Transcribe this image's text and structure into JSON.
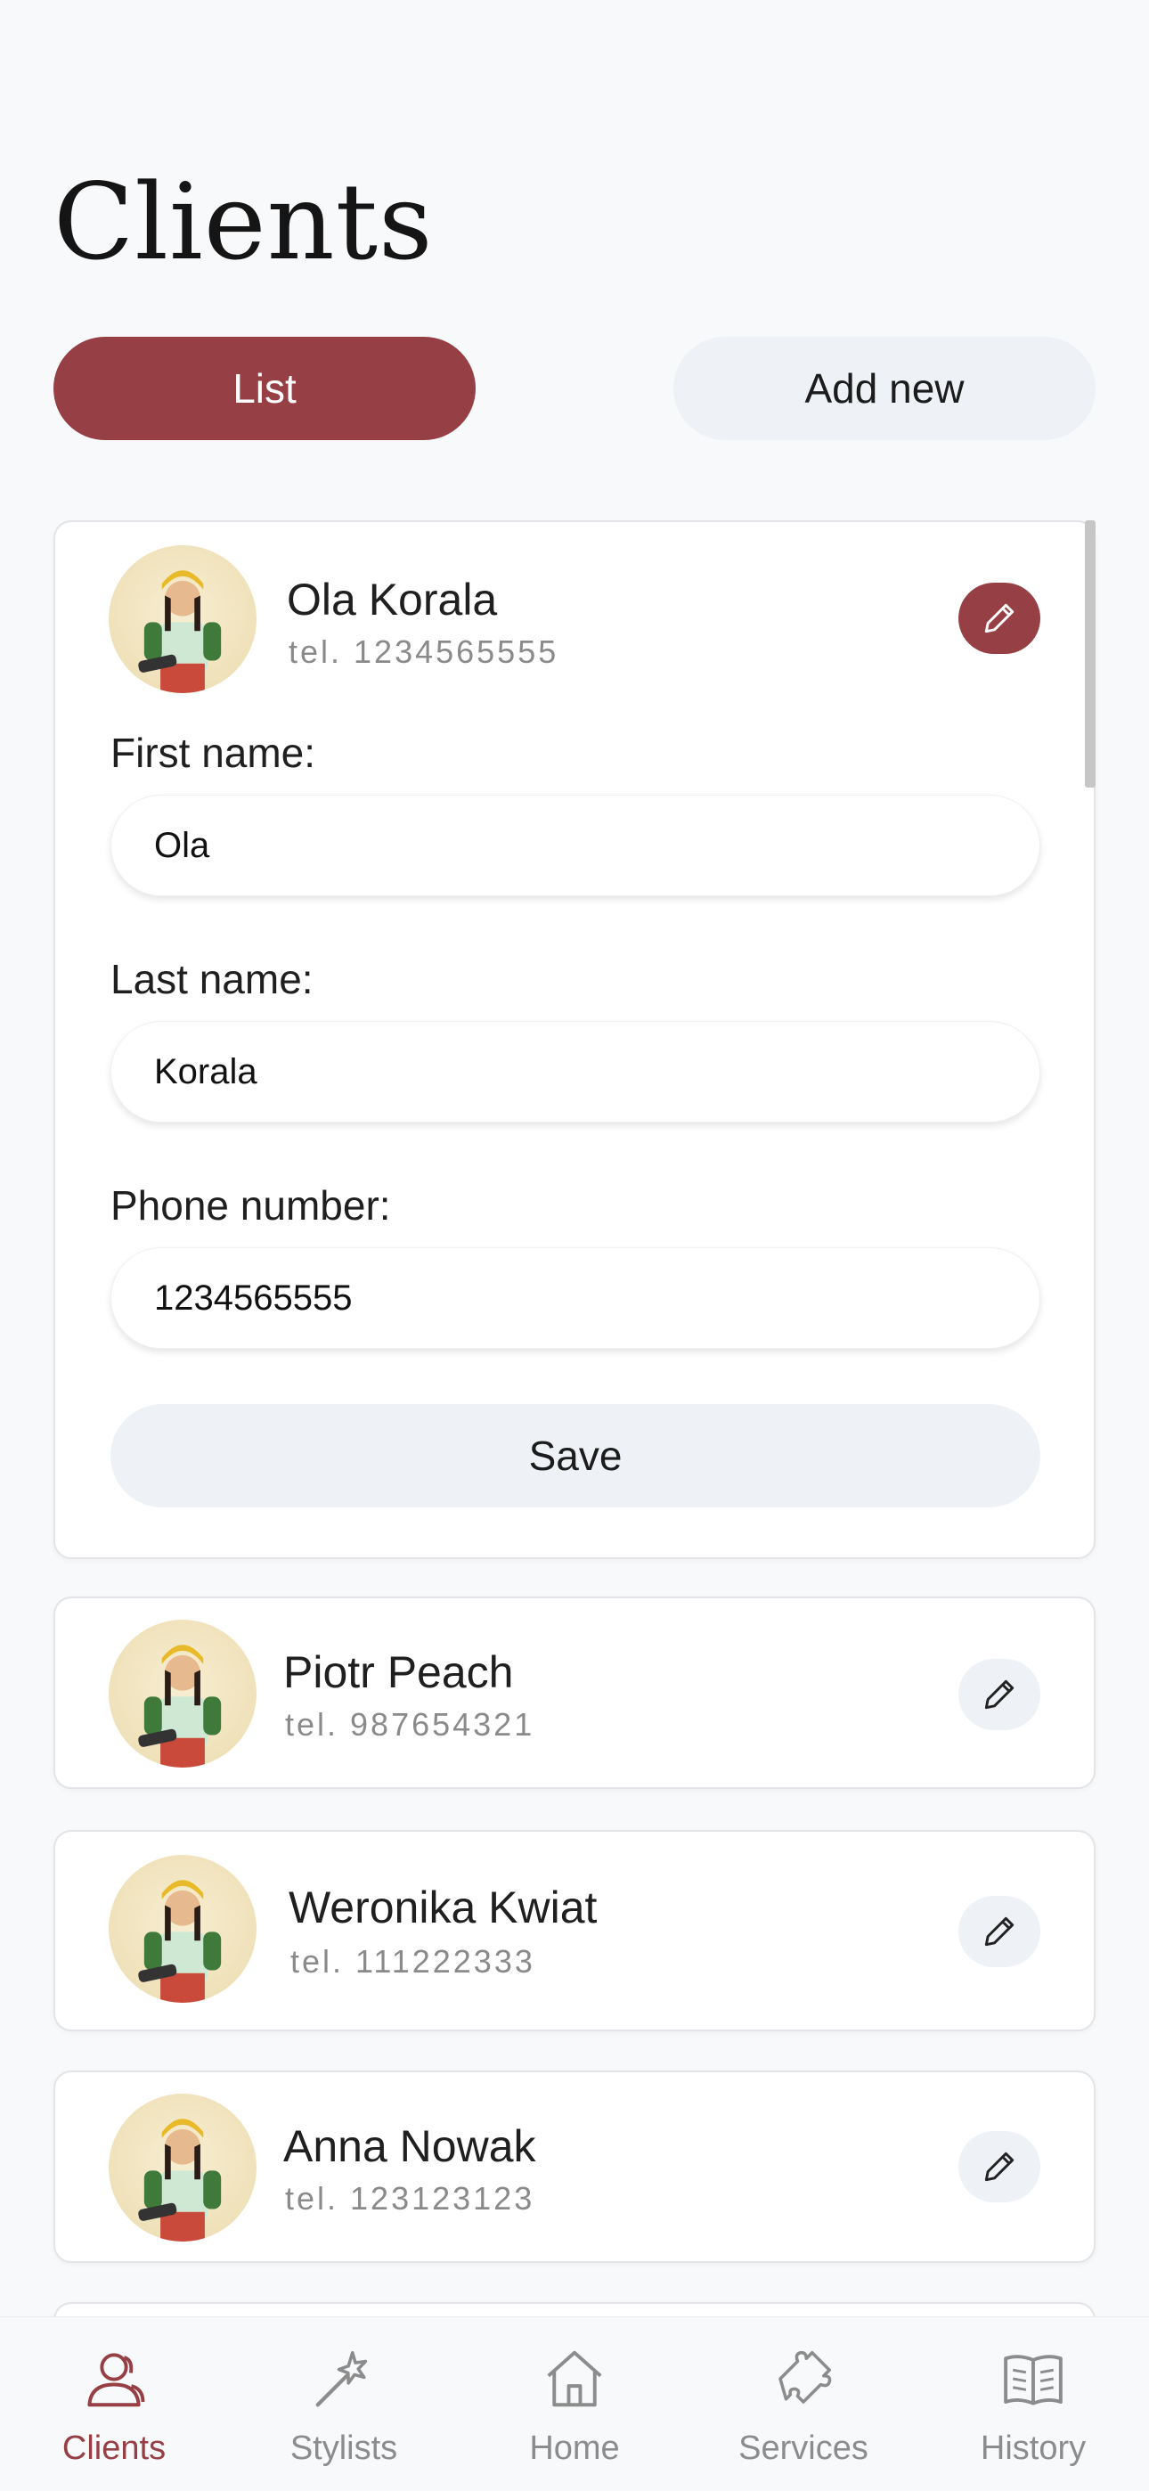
{
  "page": {
    "title": "Clients"
  },
  "segment": {
    "list_label": "List",
    "add_label": "Add new"
  },
  "form": {
    "first_name_label": "First name:",
    "last_name_label": "Last name:",
    "phone_label": "Phone number:",
    "save_label": "Save"
  },
  "clients": [
    {
      "name": "Ola Korala",
      "phone": "tel. 1234565555",
      "first_name": "Ola",
      "last_name": "Korala",
      "phone_number": "1234565555",
      "expanded": true
    },
    {
      "name": "Piotr Peach",
      "phone": "tel. 987654321"
    },
    {
      "name": "Weronika Kwiat",
      "phone": "tel. 111222333"
    },
    {
      "name": "Anna Nowak",
      "phone": "tel. 123123123"
    }
  ],
  "nav": [
    {
      "label": "Clients",
      "icon": "user-icon",
      "active": true
    },
    {
      "label": "Stylists",
      "icon": "magic-wand-icon"
    },
    {
      "label": "Home",
      "icon": "home-icon"
    },
    {
      "label": "Services",
      "icon": "puzzle-icon"
    },
    {
      "label": "History",
      "icon": "book-icon"
    }
  ],
  "colors": {
    "accent": "#963f44",
    "button_light": "#eef2f6",
    "background": "#f8f9fa",
    "muted_text": "#8a8a8a"
  }
}
